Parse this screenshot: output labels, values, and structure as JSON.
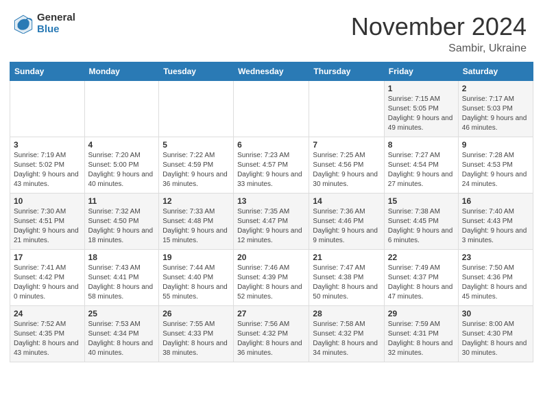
{
  "header": {
    "logo_general": "General",
    "logo_blue": "Blue",
    "month_title": "November 2024",
    "location": "Sambir, Ukraine"
  },
  "days_of_week": [
    "Sunday",
    "Monday",
    "Tuesday",
    "Wednesday",
    "Thursday",
    "Friday",
    "Saturday"
  ],
  "weeks": [
    {
      "days": [
        {
          "num": "",
          "info": ""
        },
        {
          "num": "",
          "info": ""
        },
        {
          "num": "",
          "info": ""
        },
        {
          "num": "",
          "info": ""
        },
        {
          "num": "",
          "info": ""
        },
        {
          "num": "1",
          "info": "Sunrise: 7:15 AM\nSunset: 5:05 PM\nDaylight: 9 hours\nand 49 minutes."
        },
        {
          "num": "2",
          "info": "Sunrise: 7:17 AM\nSunset: 5:03 PM\nDaylight: 9 hours\nand 46 minutes."
        }
      ]
    },
    {
      "days": [
        {
          "num": "3",
          "info": "Sunrise: 7:19 AM\nSunset: 5:02 PM\nDaylight: 9 hours\nand 43 minutes."
        },
        {
          "num": "4",
          "info": "Sunrise: 7:20 AM\nSunset: 5:00 PM\nDaylight: 9 hours\nand 40 minutes."
        },
        {
          "num": "5",
          "info": "Sunrise: 7:22 AM\nSunset: 4:59 PM\nDaylight: 9 hours\nand 36 minutes."
        },
        {
          "num": "6",
          "info": "Sunrise: 7:23 AM\nSunset: 4:57 PM\nDaylight: 9 hours\nand 33 minutes."
        },
        {
          "num": "7",
          "info": "Sunrise: 7:25 AM\nSunset: 4:56 PM\nDaylight: 9 hours\nand 30 minutes."
        },
        {
          "num": "8",
          "info": "Sunrise: 7:27 AM\nSunset: 4:54 PM\nDaylight: 9 hours\nand 27 minutes."
        },
        {
          "num": "9",
          "info": "Sunrise: 7:28 AM\nSunset: 4:53 PM\nDaylight: 9 hours\nand 24 minutes."
        }
      ]
    },
    {
      "days": [
        {
          "num": "10",
          "info": "Sunrise: 7:30 AM\nSunset: 4:51 PM\nDaylight: 9 hours\nand 21 minutes."
        },
        {
          "num": "11",
          "info": "Sunrise: 7:32 AM\nSunset: 4:50 PM\nDaylight: 9 hours\nand 18 minutes."
        },
        {
          "num": "12",
          "info": "Sunrise: 7:33 AM\nSunset: 4:48 PM\nDaylight: 9 hours\nand 15 minutes."
        },
        {
          "num": "13",
          "info": "Sunrise: 7:35 AM\nSunset: 4:47 PM\nDaylight: 9 hours\nand 12 minutes."
        },
        {
          "num": "14",
          "info": "Sunrise: 7:36 AM\nSunset: 4:46 PM\nDaylight: 9 hours\nand 9 minutes."
        },
        {
          "num": "15",
          "info": "Sunrise: 7:38 AM\nSunset: 4:45 PM\nDaylight: 9 hours\nand 6 minutes."
        },
        {
          "num": "16",
          "info": "Sunrise: 7:40 AM\nSunset: 4:43 PM\nDaylight: 9 hours\nand 3 minutes."
        }
      ]
    },
    {
      "days": [
        {
          "num": "17",
          "info": "Sunrise: 7:41 AM\nSunset: 4:42 PM\nDaylight: 9 hours\nand 0 minutes."
        },
        {
          "num": "18",
          "info": "Sunrise: 7:43 AM\nSunset: 4:41 PM\nDaylight: 8 hours\nand 58 minutes."
        },
        {
          "num": "19",
          "info": "Sunrise: 7:44 AM\nSunset: 4:40 PM\nDaylight: 8 hours\nand 55 minutes."
        },
        {
          "num": "20",
          "info": "Sunrise: 7:46 AM\nSunset: 4:39 PM\nDaylight: 8 hours\nand 52 minutes."
        },
        {
          "num": "21",
          "info": "Sunrise: 7:47 AM\nSunset: 4:38 PM\nDaylight: 8 hours\nand 50 minutes."
        },
        {
          "num": "22",
          "info": "Sunrise: 7:49 AM\nSunset: 4:37 PM\nDaylight: 8 hours\nand 47 minutes."
        },
        {
          "num": "23",
          "info": "Sunrise: 7:50 AM\nSunset: 4:36 PM\nDaylight: 8 hours\nand 45 minutes."
        }
      ]
    },
    {
      "days": [
        {
          "num": "24",
          "info": "Sunrise: 7:52 AM\nSunset: 4:35 PM\nDaylight: 8 hours\nand 43 minutes."
        },
        {
          "num": "25",
          "info": "Sunrise: 7:53 AM\nSunset: 4:34 PM\nDaylight: 8 hours\nand 40 minutes."
        },
        {
          "num": "26",
          "info": "Sunrise: 7:55 AM\nSunset: 4:33 PM\nDaylight: 8 hours\nand 38 minutes."
        },
        {
          "num": "27",
          "info": "Sunrise: 7:56 AM\nSunset: 4:32 PM\nDaylight: 8 hours\nand 36 minutes."
        },
        {
          "num": "28",
          "info": "Sunrise: 7:58 AM\nSunset: 4:32 PM\nDaylight: 8 hours\nand 34 minutes."
        },
        {
          "num": "29",
          "info": "Sunrise: 7:59 AM\nSunset: 4:31 PM\nDaylight: 8 hours\nand 32 minutes."
        },
        {
          "num": "30",
          "info": "Sunrise: 8:00 AM\nSunset: 4:30 PM\nDaylight: 8 hours\nand 30 minutes."
        }
      ]
    }
  ]
}
